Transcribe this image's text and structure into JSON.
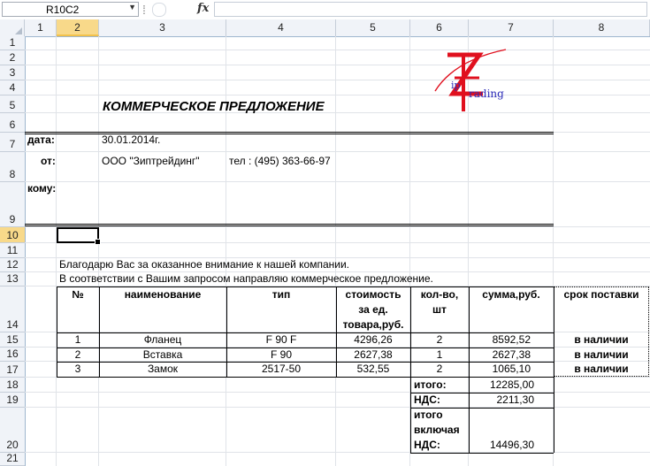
{
  "formula_bar": {
    "name_box": "R10C2",
    "fx_label": "fx",
    "formula": ""
  },
  "columns": [
    "1",
    "2",
    "3",
    "4",
    "5",
    "6",
    "7",
    "8"
  ],
  "rows": [
    "1",
    "2",
    "3",
    "4",
    "5",
    "6",
    "7",
    "8",
    "9",
    "10",
    "11",
    "12",
    "13",
    "14",
    "15",
    "16",
    "17",
    "18",
    "19",
    "20",
    "21"
  ],
  "sheet": {
    "title": "КОММЕРЧЕСКОЕ ПРЕДЛОЖЕНИЕ",
    "date_label": "дата:",
    "date_value": "30.01.2014г.",
    "from_label": "от:",
    "from_value": "ООО \"Зиптрейдинг\"",
    "phone": "тел : (495) 363-66-97",
    "to_label": "кому:",
    "line1": "Благодарю Вас за оказанное внимание к нашей компании.",
    "line2": "В соответствии с Вашим запросом направляю коммерческое предложение."
  },
  "logo": {
    "text_ip": "ip",
    "text_rading": "rading",
    "accent_red": "#e0101e",
    "accent_blue": "#2a2ab8"
  },
  "table": {
    "headers": [
      "№",
      "наименование",
      "тип",
      "стоимость за ед. товара,руб.",
      "кол-во, шт",
      "сумма,руб.",
      "срок поставки"
    ],
    "header_lines": {
      "h4": [
        "стоимость",
        "за ед.",
        "товара,руб."
      ],
      "h5": [
        "кол-во,",
        "шт"
      ]
    },
    "rows": [
      {
        "num": "1",
        "name": "Фланец",
        "type": "F 90 F",
        "price": "4296,26",
        "qty": "2",
        "sum": "8592,52",
        "delivery": "в наличии"
      },
      {
        "num": "2",
        "name": "Вставка",
        "type": "F 90",
        "price": "2627,38",
        "qty": "1",
        "sum": "2627,38",
        "delivery": "в наличии"
      },
      {
        "num": "3",
        "name": "Замок",
        "type": "2517-50",
        "price": "532,55",
        "qty": "2",
        "sum": "1065,10",
        "delivery": "в наличии"
      }
    ],
    "totals": {
      "total_label": "итого:",
      "total_value": "12285,00",
      "vat_label": "НДС:",
      "vat_value": "2211,30",
      "grand_label_1": "итого",
      "grand_label_2": "включая",
      "grand_label_3": "НДС:",
      "grand_value": "14496,30"
    }
  }
}
